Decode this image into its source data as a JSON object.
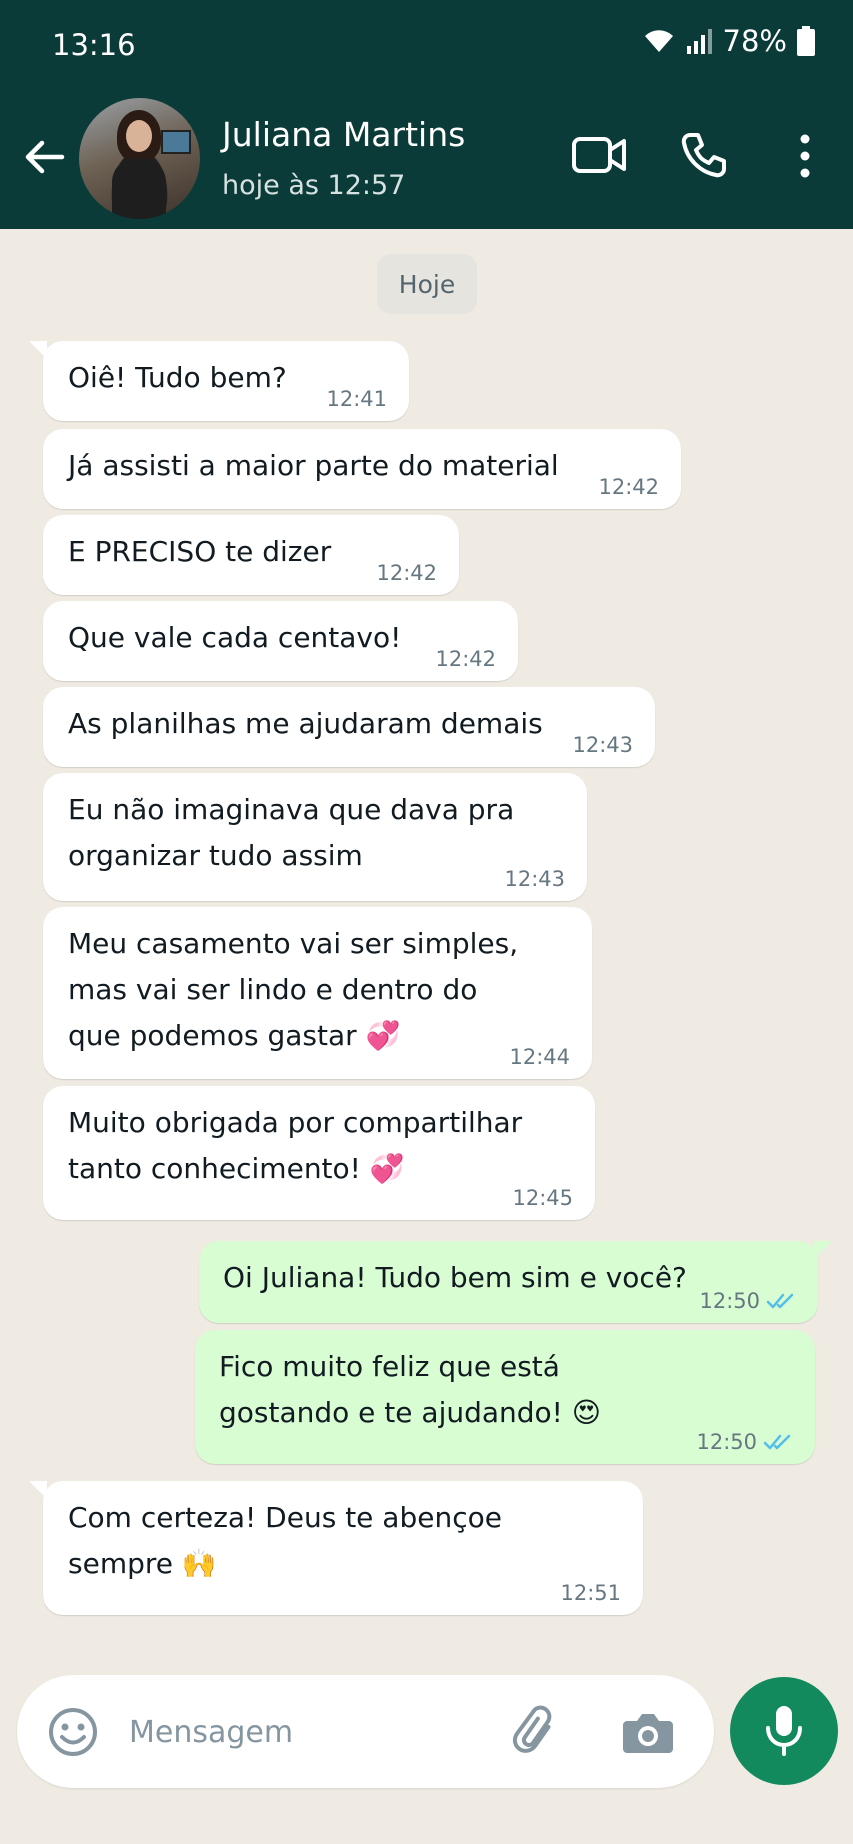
{
  "status_bar": {
    "time": "13:16",
    "battery": "78%"
  },
  "header": {
    "contact_name": "Juliana Martins",
    "last_seen": "hoje às 12:57"
  },
  "chat": {
    "date_chip": "Hoje",
    "messages": [
      {
        "text": "Oiê! Tudo bem?",
        "time": "12:41",
        "direction": "in"
      },
      {
        "text": "Já assisti a maior parte do material",
        "time": "12:42",
        "direction": "in"
      },
      {
        "text": "E PRECISO te dizer",
        "time": "12:42",
        "direction": "in"
      },
      {
        "text": "Que vale cada centavo!",
        "time": "12:42",
        "direction": "in"
      },
      {
        "text": "As planilhas me ajudaram demais",
        "time": "12:43",
        "direction": "in"
      },
      {
        "text": "Eu não imaginava que dava pra\norganizar tudo assim",
        "time": "12:43",
        "direction": "in"
      },
      {
        "text": "Meu casamento vai ser simples,\nmas vai ser lindo e dentro do\nque podemos gastar 💞",
        "time": "12:44",
        "direction": "in"
      },
      {
        "text": "Muito obrigada por compartilhar\ntanto conhecimento! 💞",
        "time": "12:45",
        "direction": "in"
      },
      {
        "text": "Oi Juliana! Tudo bem sim e você?",
        "time": "12:50",
        "direction": "out",
        "status": "read"
      },
      {
        "text": "Fico muito feliz que está\ngostando e te ajudando! 😍",
        "time": "12:50",
        "direction": "out",
        "status": "read"
      },
      {
        "text": "Com certeza! Deus te abençoe\nsempre 🙌",
        "time": "12:51",
        "direction": "in"
      }
    ]
  },
  "composer": {
    "placeholder": "Mensagem"
  },
  "icons": {
    "back": "arrow-left-icon",
    "video": "video-call-icon",
    "call": "phone-icon",
    "menu": "more-vert-icon",
    "emoji": "emoji-icon",
    "attach": "paperclip-icon",
    "camera": "camera-icon",
    "mic": "mic-icon"
  },
  "colors": {
    "header_bg": "#0b3b38",
    "chat_bg": "#efeae2",
    "incoming_bubble": "#ffffff",
    "outgoing_bubble": "#d9fdd3",
    "read_ticks": "#53bdeb",
    "mic_button": "#128a5e"
  }
}
